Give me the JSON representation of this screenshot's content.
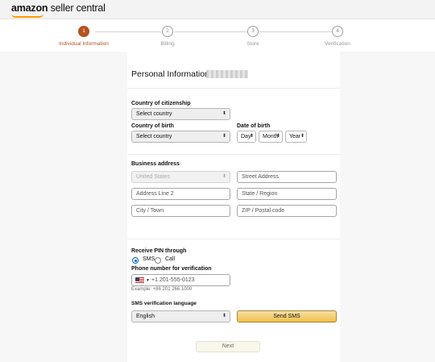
{
  "header": {
    "brand": "amazon",
    "app_name": "seller central"
  },
  "stepper": {
    "steps": [
      {
        "number": "1",
        "label": "Individual Information"
      },
      {
        "number": "2",
        "label": "Billing"
      },
      {
        "number": "3",
        "label": "Store"
      },
      {
        "number": "4",
        "label": "Verification"
      }
    ],
    "active_index": 0,
    "active_color": "#b4531e"
  },
  "form": {
    "title": "Personal Information for",
    "citizenship": {
      "label": "Country of citizenship",
      "value": "Select country"
    },
    "birth_country": {
      "label": "Country of birth",
      "value": "Select country"
    },
    "dob": {
      "label": "Date of birth",
      "day": "Day",
      "month": "Month",
      "year": "Year"
    },
    "address": {
      "label": "Business address",
      "country": "United States",
      "street_placeholder": "Street Address",
      "line2_placeholder": "Address Line 2",
      "state_placeholder": "State / Region",
      "city_placeholder": "City / Town",
      "zip_placeholder": "ZIP / Postal code"
    },
    "pin": {
      "label": "Receive PIN through",
      "options": [
        "SMS",
        "Call"
      ],
      "selected": "SMS"
    },
    "phone": {
      "label": "Phone number for verification",
      "value": "+1 201-555-0123",
      "example": "Example: +86 201 266 1000"
    },
    "sms_language": {
      "label": "SMS verification language",
      "value": "English"
    },
    "send_sms_label": "Send SMS",
    "next_label": "Next"
  }
}
